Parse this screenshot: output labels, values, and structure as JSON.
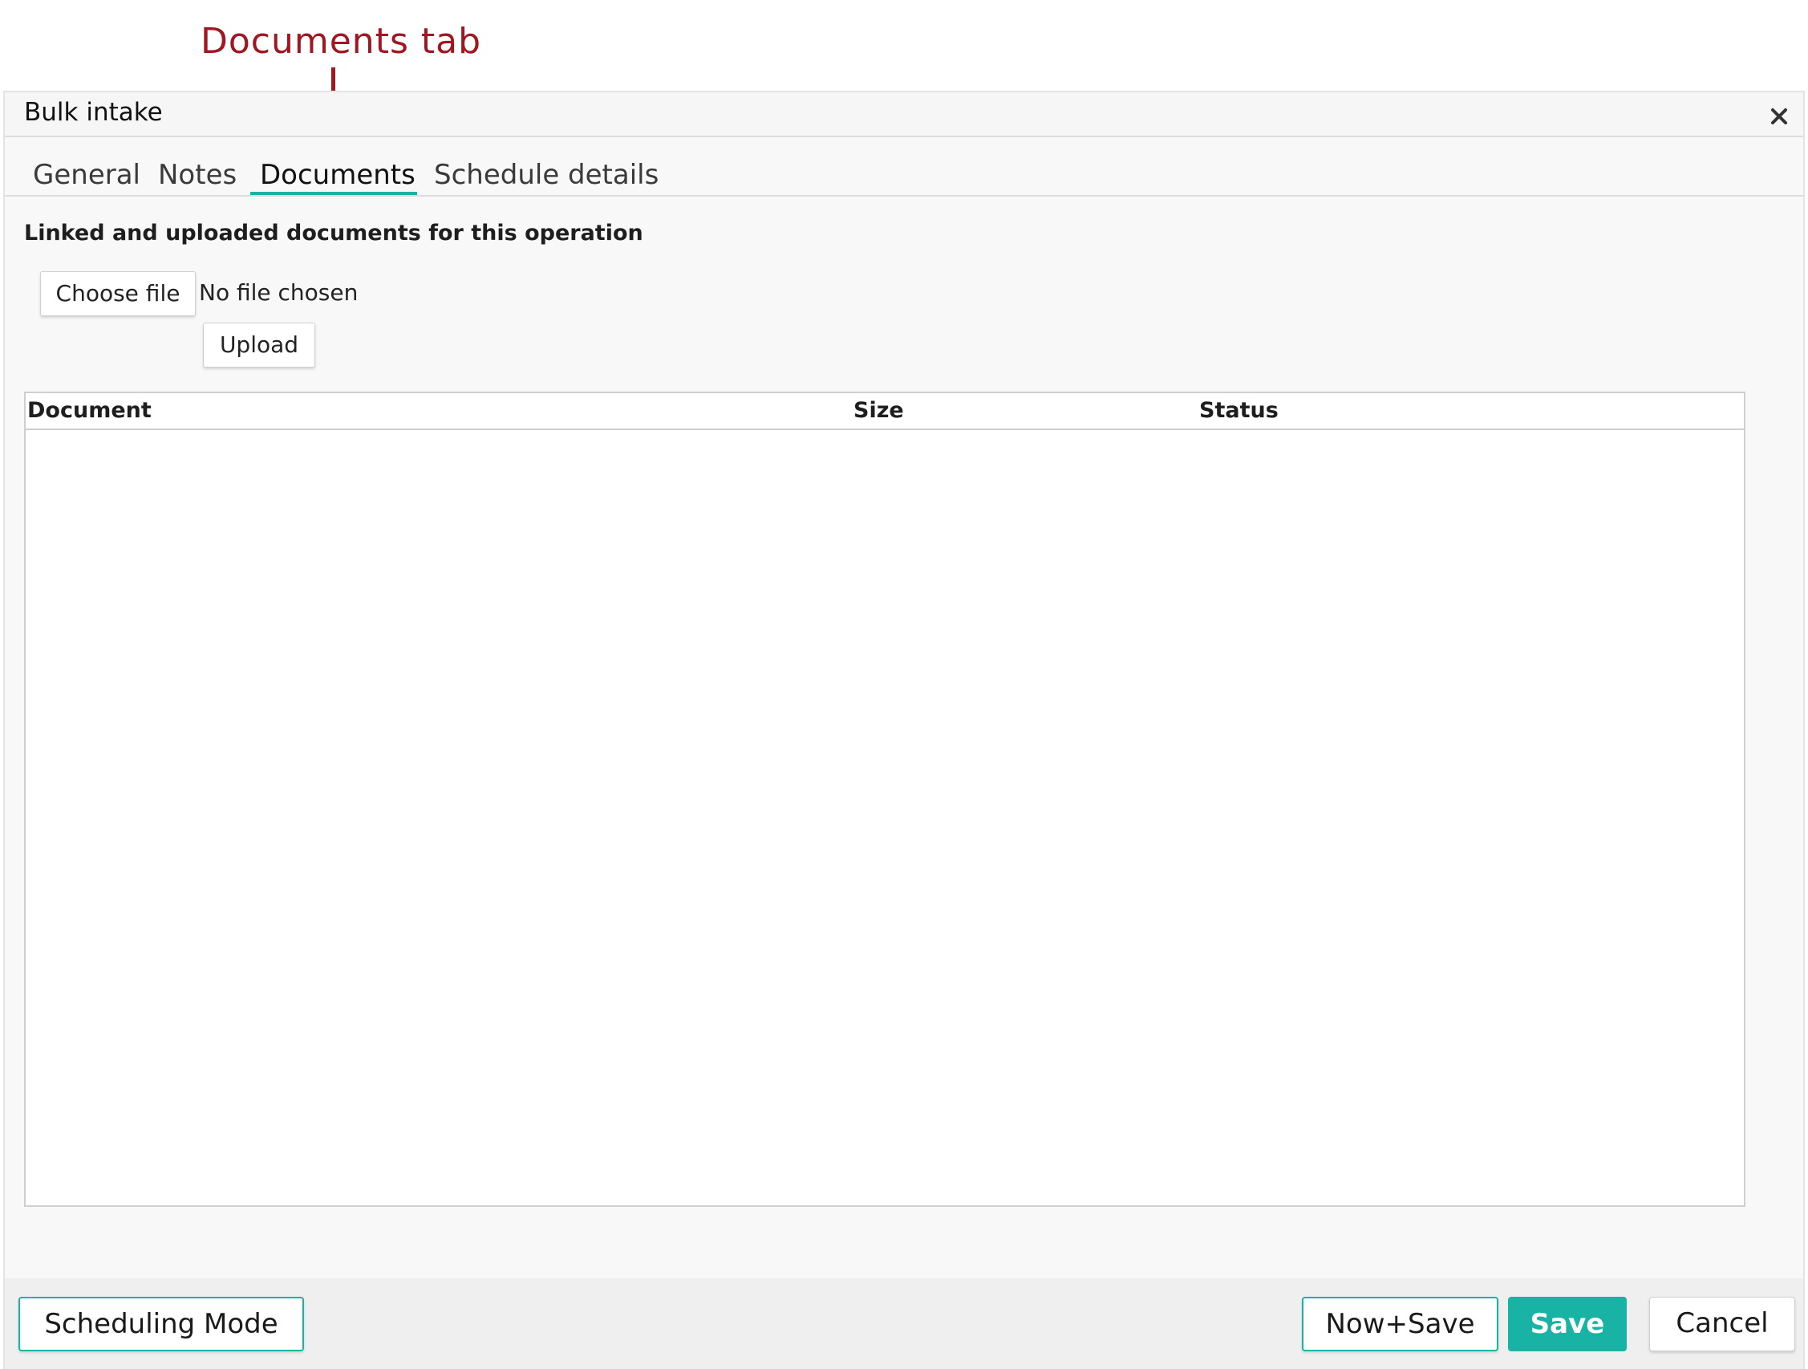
{
  "annotation": {
    "label": "Documents tab",
    "color": "#a01621"
  },
  "dialog": {
    "title": "Bulk intake",
    "close_icon": "close-icon"
  },
  "tabs": [
    {
      "label": "General",
      "active": false
    },
    {
      "label": "Notes",
      "active": false
    },
    {
      "label": "Documents",
      "active": true
    },
    {
      "label": "Schedule details",
      "active": false
    }
  ],
  "documents": {
    "heading": "Linked and uploaded documents for this operation",
    "choose_file_label": "Choose file",
    "file_status": "No file chosen",
    "upload_label": "Upload",
    "table": {
      "columns": [
        "Document",
        "Size",
        "Status"
      ],
      "rows": []
    }
  },
  "footer": {
    "scheduling_mode_label": "Scheduling Mode",
    "now_save_label": "Now+Save",
    "save_label": "Save",
    "cancel_label": "Cancel"
  },
  "colors": {
    "accent": "#19b3a6",
    "annotation": "#a01621"
  }
}
